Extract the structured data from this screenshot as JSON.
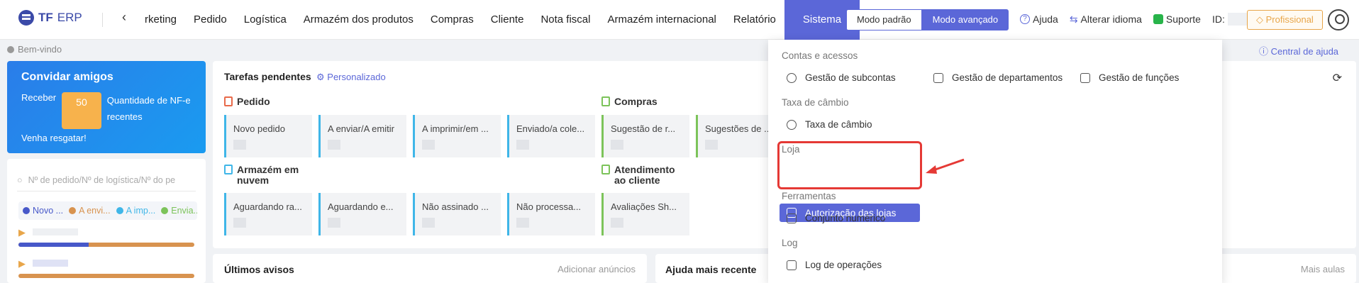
{
  "brand": {
    "name": "TF",
    "suffix": "ERP"
  },
  "nav": {
    "prev_icon": "‹",
    "items": [
      "rketing",
      "Pedido",
      "Logística",
      "Armazém dos produtos",
      "Compras",
      "Cliente",
      "Nota fiscal",
      "Armazém internacional",
      "Relatório",
      "Sistema"
    ]
  },
  "mode": {
    "standard": "Modo padrão",
    "advanced": "Modo avançado"
  },
  "tools": {
    "help": "Ajuda",
    "language": "Alterar idioma",
    "support": "Suporte",
    "id_label": "ID:",
    "pro": "Profissional"
  },
  "welcome": "Bem-vindo",
  "help_center": "Central de ajuda",
  "invite": {
    "title": "Convidar amigos",
    "receive": "Receber",
    "num": "50",
    "desc": "Quantidade de NF-e recentes",
    "claim": "Venha resgatar!"
  },
  "search": {
    "placeholder": "Nº de pedido/Nº de logística/Nº do pe"
  },
  "legend": [
    {
      "label": "Novo ...",
      "color": "#4758c9"
    },
    {
      "label": "A envi...",
      "color": "#d8934f"
    },
    {
      "label": "A imp...",
      "color": "#3fb6e8"
    },
    {
      "label": "Envia...",
      "color": "#7cc35a"
    }
  ],
  "tasks": {
    "title": "Tarefas pendentes",
    "custom": "Personalizado",
    "groups": {
      "pedido": "Pedido",
      "compras": "Compras",
      "armazem": "Armazém em nuvem",
      "atendimento": "Atendimento ao cliente"
    },
    "pedido_cards": [
      "Novo pedido",
      "A enviar/A emitir",
      "A imprimir/em ...",
      "Enviado/a cole..."
    ],
    "compras_cards": [
      "Sugestão de r...",
      "Sugestões de ..."
    ],
    "armazem_cards": [
      "Aguardando ra...",
      "Aguardando e...",
      "Não assinado ...",
      "Não processa..."
    ],
    "atendimento_cards": [
      "Avaliações Sh..."
    ]
  },
  "notices": {
    "title": "Últimos avisos",
    "action": "Adicionar anúncios"
  },
  "help_recent": {
    "title": "Ajuda mais recente",
    "more": "Mais aulas"
  },
  "menu": {
    "sec_accounts": "Contas e acessos",
    "subaccounts": "Gestão de subcontas",
    "departments": "Gestão de departamentos",
    "roles": "Gestão de funções",
    "sec_exchange": "Taxa de câmbio",
    "exchange": "Taxa de câmbio",
    "sec_store": "Loja",
    "store_auth": "Autorização das lojas",
    "sec_tools": "Ferramentas",
    "numeric_set": "Conjunto numérico",
    "sec_log": "Log",
    "op_log": "Log de operações"
  },
  "colors": {
    "accent": "#5b67d8",
    "highlight": "#e53935"
  }
}
